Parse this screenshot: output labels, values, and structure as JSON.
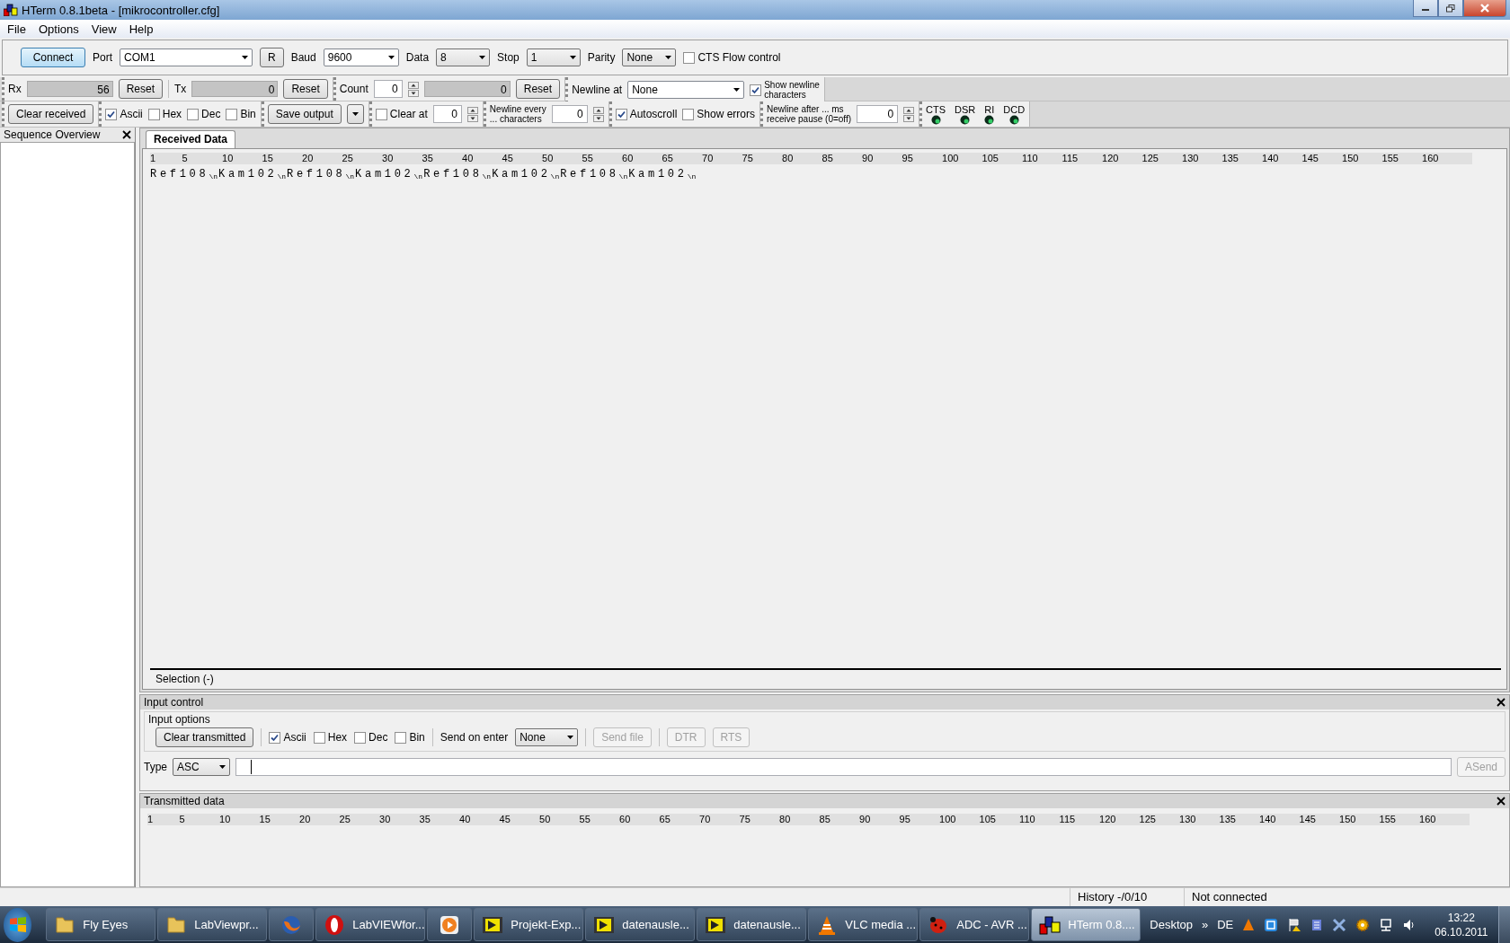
{
  "window": {
    "title": "HTerm 0.8.1beta - [mikrocontroller.cfg]"
  },
  "menu": [
    {
      "label": "File"
    },
    {
      "label": "Options"
    },
    {
      "label": "View"
    },
    {
      "label": "Help"
    }
  ],
  "connection": {
    "connect": "Connect",
    "port": {
      "label": "Port",
      "value": "COM1"
    },
    "refresh": "R",
    "baud": {
      "label": "Baud",
      "value": "9600"
    },
    "data": {
      "label": "Data",
      "value": "8"
    },
    "stop": {
      "label": "Stop",
      "value": "1"
    },
    "parity": {
      "label": "Parity",
      "value": "None"
    },
    "cts_flow": {
      "label": "CTS Flow control",
      "checked": false
    }
  },
  "counters": {
    "rx": {
      "label": "Rx",
      "value": "56",
      "reset": "Reset"
    },
    "tx": {
      "label": "Tx",
      "value": "0",
      "reset": "Reset"
    },
    "count": {
      "label": "Count",
      "value": "0",
      "total": "0",
      "reset": "Reset"
    },
    "newline_at": {
      "label": "Newline at",
      "value": "None"
    },
    "show_newline": {
      "lines": [
        "Show newline",
        "characters"
      ],
      "checked": true
    }
  },
  "display": {
    "clear_received": "Clear received",
    "formats": [
      {
        "label": "Ascii",
        "checked": true
      },
      {
        "label": "Hex",
        "checked": false
      },
      {
        "label": "Dec",
        "checked": false
      },
      {
        "label": "Bin",
        "checked": false
      }
    ],
    "save_output": "Save output",
    "clear_at": {
      "label": "Clear at",
      "checked": false,
      "value": "0"
    },
    "newline_every": {
      "lines": [
        "Newline every",
        "... characters"
      ],
      "value": "0"
    },
    "autoscroll": {
      "label": "Autoscroll",
      "checked": true
    },
    "show_errors": {
      "label": "Show errors",
      "checked": false
    },
    "newline_after": {
      "lines": [
        "Newline after ... ms",
        "receive pause (0=off)"
      ],
      "value": "0"
    },
    "signals": [
      {
        "label": "CTS"
      },
      {
        "label": "DSR"
      },
      {
        "label": "RI"
      },
      {
        "label": "DCD"
      }
    ]
  },
  "sidebar": {
    "title": "Sequence Overview"
  },
  "received": {
    "tab": {
      "label": "Received Data",
      "selected": true
    },
    "ruler": [
      "1",
      "5",
      "10",
      "15",
      "20",
      "25",
      "30",
      "35",
      "40",
      "45",
      "50",
      "55",
      "60",
      "65",
      "70",
      "75",
      "80",
      "85",
      "90",
      "95",
      "100",
      "105",
      "110",
      "115",
      "120",
      "125",
      "130",
      "135",
      "140",
      "145",
      "150",
      "155",
      "160"
    ],
    "segments": [
      {
        "text": "Ref108",
        "mark": "\\n"
      },
      {
        "text": "Kam102",
        "mark": "\\n"
      },
      {
        "text": "Ref108",
        "mark": "\\n"
      },
      {
        "text": "Kam102",
        "mark": "\\n"
      },
      {
        "text": "Ref108",
        "mark": "\\n"
      },
      {
        "text": "Kam102",
        "mark": "\\n"
      },
      {
        "text": "Ref108",
        "mark": "\\n"
      },
      {
        "text": "Kam102",
        "mark": "\\n"
      }
    ],
    "selection": "Selection (-)"
  },
  "input_control": {
    "title": "Input control",
    "group": "Input options",
    "clear_transmitted": "Clear transmitted",
    "formats": [
      {
        "label": "Ascii",
        "checked": true
      },
      {
        "label": "Hex",
        "checked": false
      },
      {
        "label": "Dec",
        "checked": false
      },
      {
        "label": "Bin",
        "checked": false
      }
    ],
    "send_on_enter": {
      "label": "Send on enter",
      "value": "None"
    },
    "buttons": [
      {
        "label": "Send file",
        "disabled": true
      },
      {
        "label": "DTR",
        "disabled": true
      },
      {
        "label": "RTS",
        "disabled": true
      }
    ],
    "type": {
      "label": "Type",
      "value": "ASC"
    },
    "asend": {
      "label": "ASend",
      "disabled": true
    }
  },
  "transmitted": {
    "title": "Transmitted data",
    "ruler": [
      "1",
      "5",
      "10",
      "15",
      "20",
      "25",
      "30",
      "35",
      "40",
      "45",
      "50",
      "55",
      "60",
      "65",
      "70",
      "75",
      "80",
      "85",
      "90",
      "95",
      "100",
      "105",
      "110",
      "115",
      "120",
      "125",
      "130",
      "135",
      "140",
      "145",
      "150",
      "155",
      "160"
    ]
  },
  "status_bar": {
    "history": "History -/0/10",
    "connection": "Not connected"
  },
  "taskbar": {
    "items": [
      {
        "kind": "folder",
        "label": "Fly Eyes",
        "selected": false
      },
      {
        "kind": "folder",
        "label": "LabViewpr...",
        "selected": false
      },
      {
        "kind": "browser",
        "selected": false
      },
      {
        "kind": "opera",
        "label": "LabVIEWfor...",
        "selected": false
      },
      {
        "kind": "player",
        "selected": false
      },
      {
        "kind": "labview",
        "label": "Projekt-Exp...",
        "selected": false
      },
      {
        "kind": "labview",
        "label": "datenausle...",
        "selected": false
      },
      {
        "kind": "labview",
        "label": "datenausle...",
        "selected": false
      },
      {
        "kind": "cone",
        "label": "VLC media ...",
        "selected": false
      },
      {
        "kind": "bug",
        "label": "ADC - AVR ...",
        "selected": false
      },
      {
        "kind": "app",
        "label": "HTerm 0.8....",
        "selected": true
      }
    ],
    "desktop": "Desktop",
    "more": "»",
    "language": "DE",
    "time": "13:22",
    "date": "06.10.2011"
  }
}
